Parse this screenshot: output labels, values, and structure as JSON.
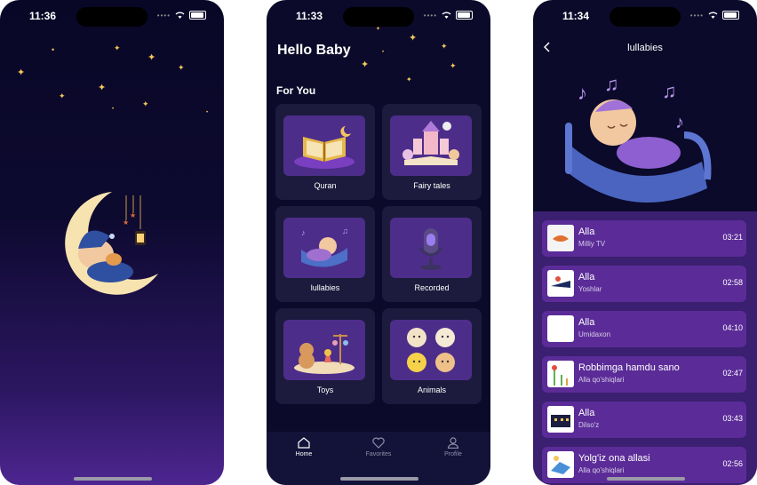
{
  "screens": {
    "splash": {
      "time": "11:36"
    },
    "home": {
      "time": "11:33",
      "greeting": "Hello Baby",
      "section_title": "For You",
      "categories": [
        {
          "label": "Quran",
          "icon": "quran-book-icon"
        },
        {
          "label": "Fairy tales",
          "icon": "fairy-castle-icon"
        },
        {
          "label": "lullabies",
          "icon": "sleeping-baby-icon"
        },
        {
          "label": "Recorded",
          "icon": "microphone-icon"
        },
        {
          "label": "Toys",
          "icon": "toys-icon"
        },
        {
          "label": "Animals",
          "icon": "animals-icon"
        }
      ],
      "tabs": [
        {
          "label": "Home",
          "icon": "home-icon",
          "active": true
        },
        {
          "label": "Favorites",
          "icon": "heart-icon",
          "active": false
        },
        {
          "label": "Profile",
          "icon": "profile-icon",
          "active": false
        }
      ]
    },
    "lullabies": {
      "time": "11:34",
      "title": "lullabies",
      "songs": [
        {
          "title": "Alla",
          "artist": "Milliy TV",
          "duration": "03:21"
        },
        {
          "title": "Alla",
          "artist": "Yoshlar",
          "duration": "02:58"
        },
        {
          "title": "Alla",
          "artist": "Umidaxon",
          "duration": "04:10"
        },
        {
          "title": "Robbimga hamdu sano",
          "artist": "Alla qo'shiqlari",
          "duration": "02:47"
        },
        {
          "title": "Alla",
          "artist": "Dilso'z",
          "duration": "03:43"
        },
        {
          "title": "Yolg'iz ona allasi",
          "artist": "Alla qo'shiqlari",
          "duration": "02:56"
        }
      ]
    }
  },
  "colors": {
    "background": "#0b0a2a",
    "card": "#1c1b3d",
    "accent_purple": "#5b2c98",
    "star_gold": "#f3c75d"
  }
}
